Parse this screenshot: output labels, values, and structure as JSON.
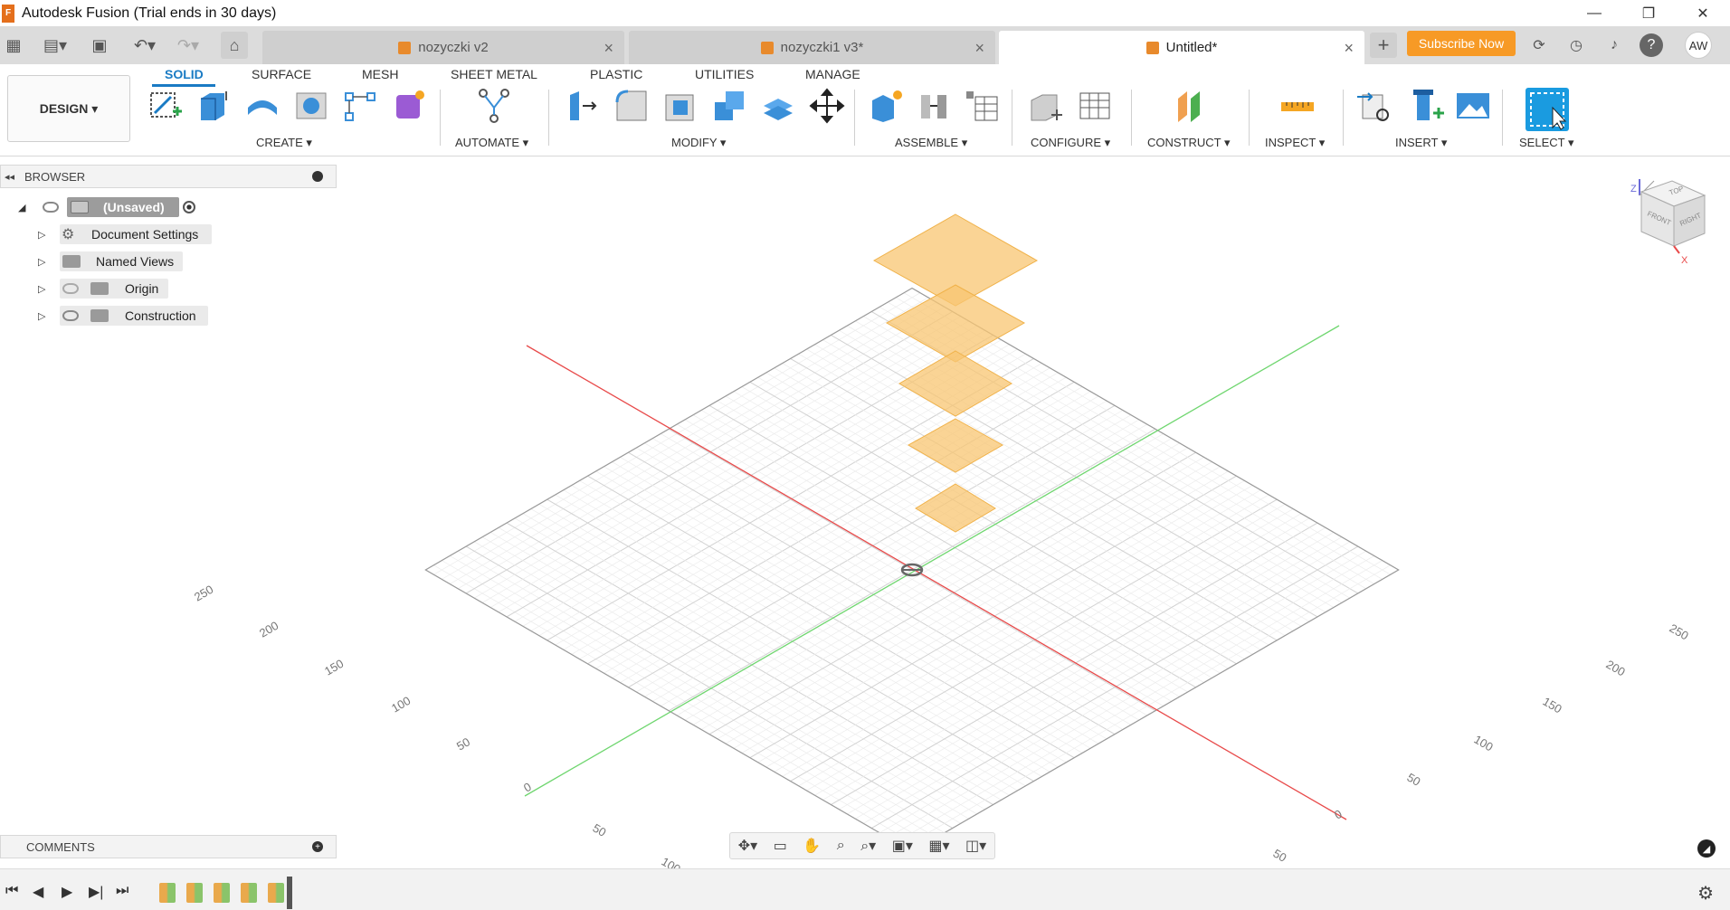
{
  "window": {
    "title": "Autodesk Fusion (Trial ends in 30 days)",
    "minimize": "—",
    "restore": "❐",
    "close": "✕"
  },
  "tabs": [
    {
      "name": "nozyczki v2",
      "active": false
    },
    {
      "name": "nozyczki1 v3*",
      "active": false
    },
    {
      "name": "Untitled*",
      "active": true
    }
  ],
  "header": {
    "subscribe": "Subscribe Now",
    "user_initials": "AW",
    "plus": "+",
    "close": "×"
  },
  "toolbar": {
    "workspace": "DESIGN ▾",
    "tabs": [
      "SOLID",
      "SURFACE",
      "MESH",
      "SHEET METAL",
      "PLASTIC",
      "UTILITIES",
      "MANAGE"
    ],
    "groups": [
      "CREATE ▾",
      "AUTOMATE ▾",
      "MODIFY ▾",
      "ASSEMBLE ▾",
      "CONFIGURE ▾",
      "CONSTRUCT ▾",
      "INSPECT ▾",
      "INSERT ▾",
      "SELECT ▾"
    ]
  },
  "browser": {
    "title": "BROWSER",
    "collapse": "◂◂",
    "root": "(Unsaved)",
    "items": [
      "Document Settings",
      "Named Views",
      "Origin",
      "Construction"
    ]
  },
  "comments": {
    "title": "COMMENTS"
  },
  "viewcube": {
    "top": "TOP",
    "front": "FRONT",
    "right": "RIGHT",
    "z": "Z",
    "x": "X"
  },
  "grid_labels": {
    "left": [
      "250",
      "200",
      "150",
      "100",
      "50",
      "0"
    ],
    "bottom": [
      "50",
      "100"
    ],
    "right": [
      "250",
      "200",
      "150",
      "100",
      "50",
      "0"
    ],
    "bottom_right": [
      "50"
    ]
  },
  "colors": {
    "accent": "#1a7bc4",
    "subscribe": "#f79a26",
    "sketch_fill": "#f8c571",
    "x_axis": "#e84a4a",
    "y_axis": "#6fd66f"
  }
}
